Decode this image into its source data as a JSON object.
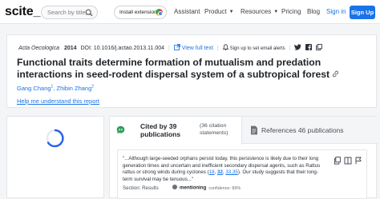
{
  "nav": {
    "logo": "scite_",
    "search_placeholder": "Search by title, ...",
    "extension_label": "Install extension!",
    "links": {
      "assistant": "Assistant",
      "product": "Product",
      "resources": "Resources",
      "pricing": "Pricing",
      "blog": "Blog"
    },
    "sign_in": "Sign in",
    "sign_up": "Sign Up"
  },
  "paper": {
    "journal": "Acta Oecologica",
    "year": "2014",
    "doi": "DOI: 10.1016/j.actao.2013.11.004",
    "view_full_text": "View full text",
    "alerts": "Sign up to set email alerts",
    "title": "Functional traits determine formation of mutualism and predation interactions in seed-rodent dispersal system of a subtropical forest",
    "authors": [
      {
        "name": "Gang Chang",
        "sup": "1"
      },
      {
        "name": "Zhibin Zhang",
        "sup": "2"
      }
    ],
    "help_link": "Help me understand this report"
  },
  "tabs": {
    "cited_by": "Cited by 39 publications",
    "citation_statements": "(36 citation statements)",
    "references": "References 46 publications"
  },
  "citation": {
    "text_before": "\"...Although large-seeded orphans persist today, this persistence is likely due to their long generation times and uncertain and inefficient secondary dispersal agents, such as Rattus rattus or strong winds during cyclones (",
    "ref1": "18",
    "ref2": "32",
    "ref3": "33,35",
    "text_after": "). Our study suggests that their long-term survival may be tenuous...\"",
    "section_label": "Section: Results",
    "badge_label": "mentioning",
    "confidence": "confidence: 89%"
  },
  "colors": {
    "accent": "#1a73e8",
    "spinner": "#2563eb",
    "quote_icon": "#2e9d5a"
  }
}
